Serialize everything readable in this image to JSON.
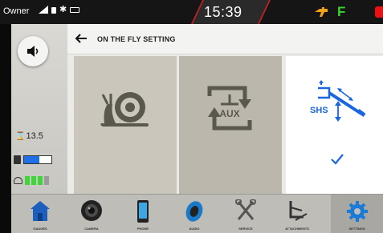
{
  "status_bar": {
    "owner": "Owner",
    "time": "15:39",
    "gear": "F"
  },
  "left_panel": {
    "hours": "13.5",
    "fuel_level": 0.55,
    "def_level_bars": 3,
    "def_total_bars": 4
  },
  "header": {
    "title": "ON THE FLY SETTING"
  },
  "tiles": [
    {
      "name": "slow-mode",
      "icon": "snail-icon"
    },
    {
      "name": "aux",
      "icon_label": "AUX"
    },
    {
      "name": "shs",
      "label": "SHS",
      "selected": true
    }
  ],
  "nav": [
    {
      "label": "GAUGES",
      "icon": "home-icon"
    },
    {
      "label": "CAMERA",
      "icon": "camera-icon"
    },
    {
      "label": "PHONE",
      "icon": "phone-icon"
    },
    {
      "label": "AUDIO",
      "icon": "audio-icon"
    },
    {
      "label": "SERVICE",
      "icon": "wrench-icon"
    },
    {
      "label": "ATTACHMENTS",
      "icon": "attachment-icon"
    },
    {
      "label": "SETTINGS",
      "icon": "gear-icon",
      "active": true
    }
  ],
  "colors": {
    "accent_blue": "#1a66e0",
    "status_green": "#39d430",
    "alert_red": "#e11111"
  }
}
